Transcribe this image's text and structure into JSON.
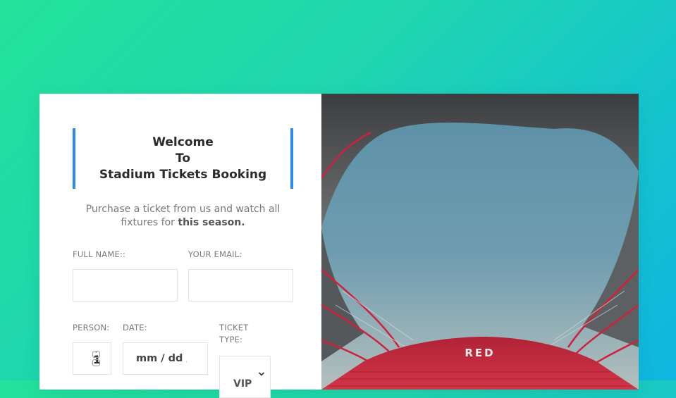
{
  "welcome": {
    "line1": "Welcome",
    "line2": "To",
    "line3": "Stadium Tickets Booking"
  },
  "intro": {
    "text": "Purchase a ticket from us and watch all fixtures for",
    "bold": "this season."
  },
  "form": {
    "full_name_label": "FULL NAME::",
    "full_name_value": "",
    "email_label": "YOUR EMAIL:",
    "email_value": "",
    "person_label": "PERSON:",
    "person_value": "1",
    "date_label": "DATE:",
    "date_placeholder": "mm / dd / yyyy",
    "ticket_type_label_1": "TICKET",
    "ticket_type_label_2": "TYPE:",
    "ticket_type_value": "VIP"
  },
  "photo": {
    "stadium_sign": "RED",
    "description_icon": "stadium-photo"
  },
  "colors": {
    "accent": "#2a8cf0",
    "background_from": "#23e29a",
    "background_to": "#0fb6e0",
    "stadium_seats": "#c8283a"
  }
}
